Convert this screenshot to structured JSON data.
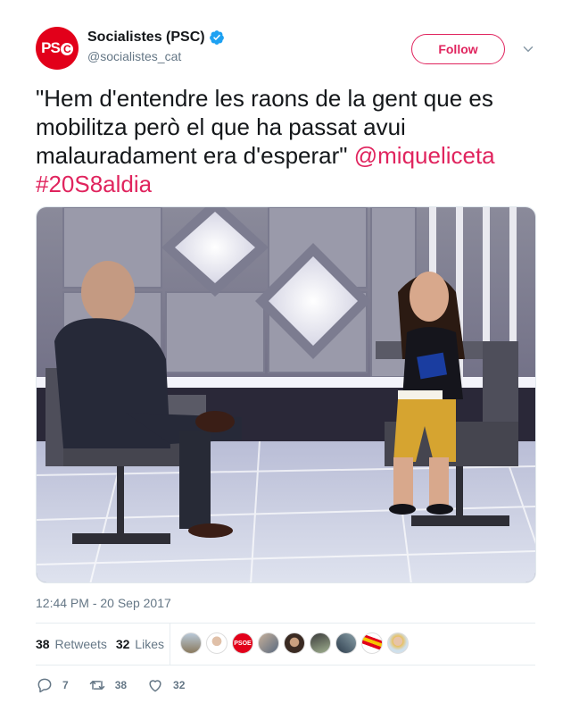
{
  "account": {
    "display_name": "Socialistes (PSC)",
    "handle": "@socialistes_cat",
    "avatar_text": "PS",
    "avatar_text_c": "C"
  },
  "follow_label": "Follow",
  "tweet": {
    "text": "\"Hem d'entendre les raons de la gent que es mobilitza però el que ha passat avui malauradament era d'esperar\"",
    "mention": "@miqueliceta",
    "hashtag": "#20S8aldia"
  },
  "timestamp": "12:44 PM - 20 Sep 2017",
  "stats": {
    "retweets_count": "38",
    "retweets_label": "Retweets",
    "likes_count": "32",
    "likes_label": "Likes"
  },
  "likers_badge": "PSOE",
  "actions": {
    "reply_count": "7",
    "retweet_count": "38",
    "like_count": "32"
  },
  "colors": {
    "accent": "#e0245e",
    "brand": "#e2001a",
    "verified": "#1da1f2"
  }
}
